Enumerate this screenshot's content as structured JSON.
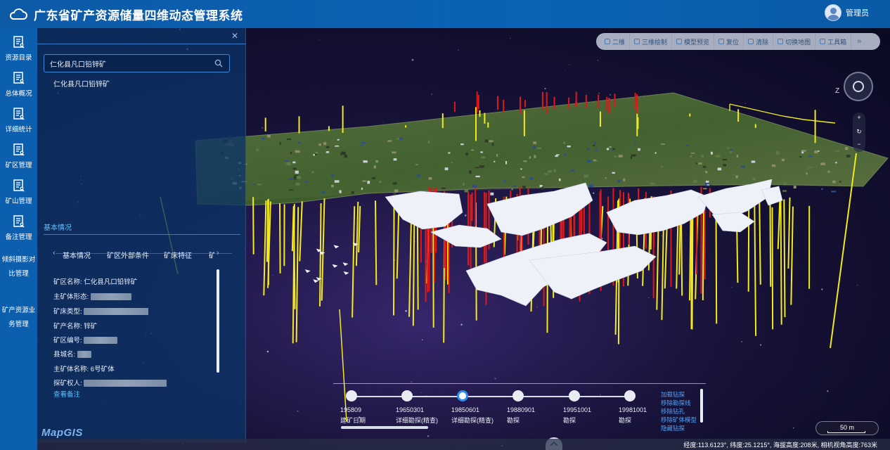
{
  "header": {
    "title": "广东省矿产资源储量四维动态管理系统",
    "user": "管理员",
    "logo_icon": "cloud-icon"
  },
  "nav": {
    "items": [
      {
        "label": "资源目录",
        "icon": "document-list-icon"
      },
      {
        "label": "总体概况",
        "icon": "document-list-icon"
      },
      {
        "label": "详细统计",
        "icon": "document-list-icon"
      },
      {
        "label": "矿区管理",
        "icon": "document-list-icon"
      },
      {
        "label": "矿山管理",
        "icon": "document-list-icon"
      },
      {
        "label": "备注管理",
        "icon": "document-list-icon"
      },
      {
        "label": "倾斜摄影对",
        "label2": "比管理",
        "icon": "document-list-icon"
      },
      {
        "label": "矿产资源业",
        "label2": "务管理",
        "icon": "pie-chart-icon"
      }
    ]
  },
  "panel": {
    "search": {
      "value": "仁化县凡口铅锌矿",
      "placeholder": ""
    },
    "result": "仁化县凡口铅锌矿",
    "section_title": "基本情况",
    "tabs": [
      "基本情况",
      "矿区外部条件",
      "矿床特征",
      "矿"
    ],
    "fields": [
      {
        "label": "矿区名称:",
        "value": "仁化县凡口铅锌矿"
      },
      {
        "label": "主矿体形态:",
        "value": ""
      },
      {
        "label": "矿床类型:",
        "value": ""
      },
      {
        "label": "矿产名称:",
        "value": "锌矿"
      },
      {
        "label": "矿区编号:",
        "value": ""
      },
      {
        "label": "县城名:",
        "value": ""
      },
      {
        "label": "主矿体名称:",
        "value": "6号矿体"
      },
      {
        "label": "探矿权人:",
        "value": ""
      }
    ],
    "more_link": "查看备注",
    "brand": "MapGIS"
  },
  "toolbar": {
    "items": [
      "二维",
      "三维绘制",
      "模型预览",
      "复位",
      "清除",
      "切换地图",
      "工具箱"
    ],
    "more": "»"
  },
  "compass": {
    "label": "Z"
  },
  "zoom": {
    "plus": "+",
    "reset": "↻",
    "minus": "−"
  },
  "timeline": {
    "nodes": [
      {
        "date": "195809",
        "name": "建矿日期",
        "active": false
      },
      {
        "date": "19650301",
        "name": "详细勘探(精查)",
        "active": false
      },
      {
        "date": "19850601",
        "name": "详细勘探(精查)",
        "active": true
      },
      {
        "date": "19880901",
        "name": "勘探",
        "active": false
      },
      {
        "date": "19951001",
        "name": "勘探",
        "active": false
      },
      {
        "date": "19981001",
        "name": "勘探",
        "active": false
      }
    ],
    "actions": [
      "加载钻探",
      "移除勘探线",
      "移除钻孔",
      "移除矿体模型",
      "隐藏钻探"
    ]
  },
  "scale": {
    "label": "50 m"
  },
  "status": {
    "text": "经度:113.6123°, 纬度:25.1215°, 海拔高度:208米, 相机视角高度:763米"
  },
  "colors": {
    "header": "#0b63b6",
    "nav": "#0c5fae",
    "accent": "#2d8cf0",
    "drill_yellow": "#f2ea1a",
    "drill_red": "#e01818"
  }
}
